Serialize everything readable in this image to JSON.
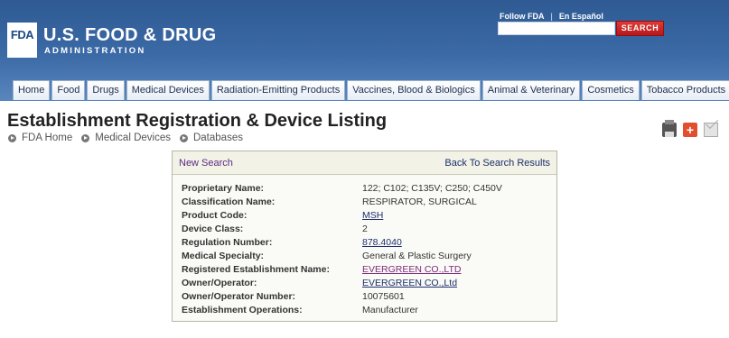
{
  "header": {
    "logo_mark": "FDA",
    "title": "U.S. FOOD & DRUG",
    "subtitle": "ADMINISTRATION",
    "util_links": [
      "Follow FDA",
      "En Español"
    ],
    "search": {
      "placeholder": "",
      "button_label": "SEARCH"
    }
  },
  "nav": {
    "tabs": [
      "Home",
      "Food",
      "Drugs",
      "Medical Devices",
      "Radiation-Emitting Products",
      "Vaccines, Blood & Biologics",
      "Animal & Veterinary",
      "Cosmetics",
      "Tobacco Products"
    ]
  },
  "page": {
    "title": "Establishment Registration & Device Listing",
    "breadcrumb": [
      "FDA Home",
      "Medical Devices",
      "Databases"
    ]
  },
  "tools": {
    "icons": [
      "print-icon",
      "plus-icon",
      "mail-icon"
    ]
  },
  "panel": {
    "new_search": "New Search",
    "back_link": "Back To Search Results",
    "rows": [
      {
        "label": "Proprietary Name:",
        "value": "122; C102; C135V; C250; C450V"
      },
      {
        "label": "Classification Name:",
        "value": "RESPIRATOR, SURGICAL"
      },
      {
        "label": "Product Code:",
        "value": "MSH"
      },
      {
        "label": "Device Class:",
        "value": "2"
      },
      {
        "label": "Regulation Number:",
        "value": "878.4040"
      },
      {
        "label": "Medical Specialty:",
        "value": "General & Plastic Surgery"
      },
      {
        "label": "Registered Establishment Name:",
        "value": "EVERGREEN CO.,LTD"
      },
      {
        "label": "Owner/Operator:",
        "value": "EVERGREEN CO.,Ltd"
      },
      {
        "label": "Owner/Operator Number:",
        "value": "10075601"
      },
      {
        "label": "Establishment Operations:",
        "value": "Manufacturer"
      }
    ]
  }
}
